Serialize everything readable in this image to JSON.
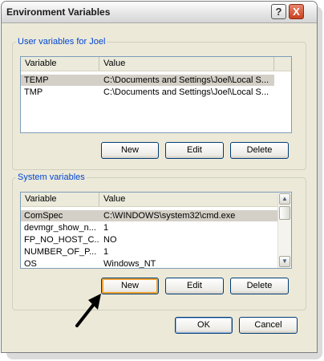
{
  "window": {
    "title": "Environment Variables",
    "help_glyph": "?",
    "close_glyph": "X"
  },
  "user_vars": {
    "legend": "User variables for Joel",
    "columns": [
      "Variable",
      "Value"
    ],
    "rows": [
      {
        "name": "TEMP",
        "value": "C:\\Documents and Settings\\Joel\\Local S..."
      },
      {
        "name": "TMP",
        "value": "C:\\Documents and Settings\\Joel\\Local S..."
      }
    ],
    "buttons": {
      "new": "New",
      "edit": "Edit",
      "delete": "Delete"
    }
  },
  "system_vars": {
    "legend": "System variables",
    "columns": [
      "Variable",
      "Value"
    ],
    "rows": [
      {
        "name": "ComSpec",
        "value": "C:\\WINDOWS\\system32\\cmd.exe"
      },
      {
        "name": "devmgr_show_n...",
        "value": "1"
      },
      {
        "name": "FP_NO_HOST_C...",
        "value": "NO"
      },
      {
        "name": "NUMBER_OF_P...",
        "value": "1"
      },
      {
        "name": "OS",
        "value": "Windows_NT"
      }
    ],
    "buttons": {
      "new": "New",
      "edit": "Edit",
      "delete": "Delete"
    }
  },
  "footer": {
    "ok": "OK",
    "cancel": "Cancel"
  },
  "icons": {
    "arrow_annotation": "black-arrow-pointing-to-new-button",
    "scroll_up": "chevron-up-icon",
    "scroll_down": "chevron-down-icon"
  },
  "colors": {
    "legend": "#0046d5",
    "selected_row": "#d4d0c8",
    "focus_ring": "#f1a335",
    "close_button": "#c8401e"
  }
}
